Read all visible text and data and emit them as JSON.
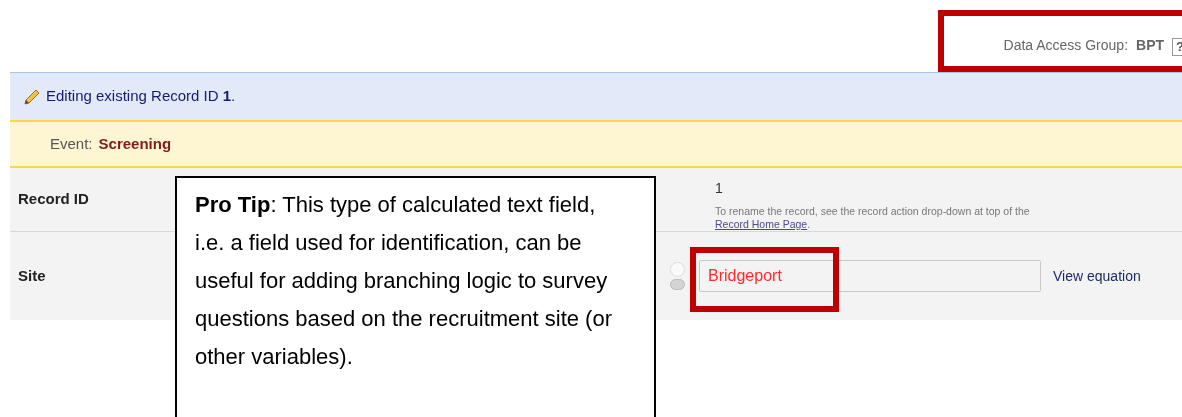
{
  "header": {
    "dag_label": "Data Access Group:",
    "dag_value": "BPT",
    "help": "?"
  },
  "editing_bar": {
    "text": "Editing existing Record ID **1**."
  },
  "event_bar": {
    "label": "Event:",
    "value": "Screening"
  },
  "fields": [
    {
      "kind": "record_id",
      "label": "Record ID",
      "value": "1",
      "note": "To rename the record, see the record action drop-down at top of the",
      "link": "Record Home Page",
      "after": "."
    },
    {
      "kind": "calc",
      "label": "Site",
      "value": "Bridgeport",
      "action": "View equation"
    }
  ],
  "callout": {
    "text": "**Pro Tip**: This type of calculated text field, i.e. a field used for identification, can be useful for adding branching logic to survey questions based on the recruitment site (or other variables)."
  }
}
